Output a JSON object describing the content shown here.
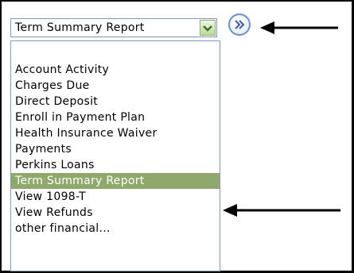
{
  "select": {
    "value": "Term Summary Report"
  },
  "icons": {
    "select_arrow": "chevron-down-icon",
    "go_button": "double-chevron-right-icon",
    "annotation_arrow": "left-arrow-icon"
  },
  "listbox": {
    "items": [
      {
        "label": ""
      },
      {
        "label": "Account Activity"
      },
      {
        "label": "Charges Due"
      },
      {
        "label": "Direct Deposit"
      },
      {
        "label": "Enroll in Payment Plan"
      },
      {
        "label": "Health Insurance Waiver"
      },
      {
        "label": "Payments"
      },
      {
        "label": "Perkins Loans"
      },
      {
        "label": "Term Summary Report",
        "selected": true
      },
      {
        "label": "View 1098-T"
      },
      {
        "label": "View Refunds"
      },
      {
        "label": "other financial..."
      }
    ]
  },
  "colors": {
    "selected_background": "#8fa86b",
    "selected_text": "#ffffff",
    "border": "#7f9db9",
    "arrow_accent": "#000000"
  }
}
